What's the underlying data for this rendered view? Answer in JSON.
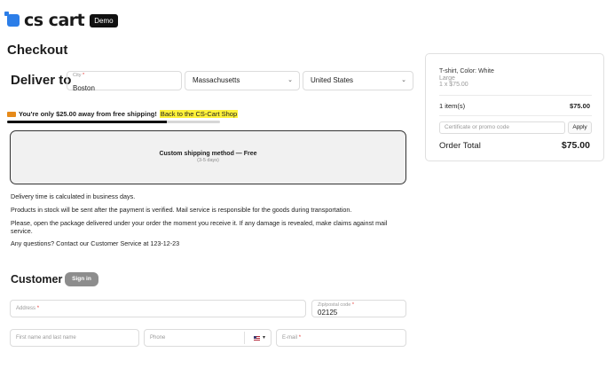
{
  "header": {
    "logo_text": "cs cart",
    "badge": "Demo",
    "brand_color": "#2c7ee8"
  },
  "page_title": "Checkout",
  "delivery": {
    "title": "Deliver to",
    "city_label": "City",
    "city_value": "Boston",
    "state": "Massachusetts",
    "country": "United States"
  },
  "shipping_note": {
    "text": "You're only $25.00 away from free shipping!",
    "link": "Back to the CS-Cart Shop",
    "progress": 0.75
  },
  "shipping_method": {
    "name": "Custom shipping method — Free",
    "days": "(3-5 days)"
  },
  "info_lines": [
    "Delivery time is calculated in business days.",
    "Products in stock will be sent after the payment is verified. Mail service is responsible for the goods during transportation.",
    "Please, open the package delivered under your order the moment you receive it. If any damage is revealed, make claims against mail service.",
    "Any questions? Contact our Customer Service at 123-12-23"
  ],
  "customer": {
    "title": "Customer",
    "sign_in": "Sign in",
    "address_placeholder": "Address",
    "zip_label": "Zip/postal code",
    "zip_value": "02125",
    "name_placeholder": "First name and last name",
    "phone_placeholder": "Phone",
    "email_placeholder": "E-mail"
  },
  "summary": {
    "product_name": "T-shirt, Color: White",
    "product_option": "Large",
    "product_qty": "1 x $75.00",
    "items_label": "1 item(s)",
    "items_price": "$75.00",
    "promo_placeholder": "Certificate or promo code",
    "apply_label": "Apply",
    "total_label": "Order Total",
    "total_value": "$75.00"
  }
}
